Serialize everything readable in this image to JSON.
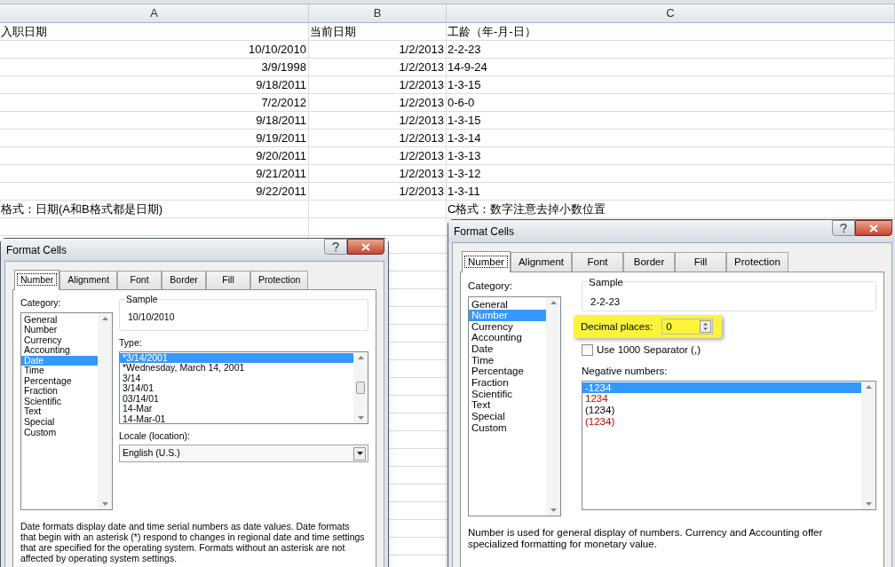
{
  "sheet": {
    "columns": [
      "A",
      "B",
      "C"
    ],
    "header": [
      "入职日期",
      "当前日期",
      "工龄（年-月-日）"
    ],
    "rows": [
      [
        "10/10/2010",
        "1/2/2013",
        "2-2-23"
      ],
      [
        "3/9/1998",
        "1/2/2013",
        "14-9-24"
      ],
      [
        "9/18/2011",
        "1/2/2013",
        "1-3-15"
      ],
      [
        "7/2/2012",
        "1/2/2013",
        "0-6-0"
      ],
      [
        "9/18/2011",
        "1/2/2013",
        "1-3-15"
      ],
      [
        "9/19/2011",
        "1/2/2013",
        "1-3-14"
      ],
      [
        "9/20/2011",
        "1/2/2013",
        "1-3-13"
      ],
      [
        "9/21/2011",
        "1/2/2013",
        "1-3-12"
      ],
      [
        "9/22/2011",
        "1/2/2013",
        "1-3-11"
      ]
    ],
    "note_a": "格式：日期(A和B格式都是日期)",
    "note_c": "C格式：数字注意去掉小数位置"
  },
  "dialogs": [
    {
      "kind": "date",
      "title": "Format Cells",
      "tabs": [
        {
          "label": "Number",
          "selected": true
        },
        {
          "label": "Alignment",
          "selected": false
        },
        {
          "label": "Font",
          "selected": false
        },
        {
          "label": "Border",
          "selected": false
        },
        {
          "label": "Fill",
          "selected": false
        },
        {
          "label": "Protection",
          "selected": false
        }
      ],
      "category_label": "Category:",
      "categories": [
        {
          "label": "General",
          "selected": false
        },
        {
          "label": "Number",
          "selected": false
        },
        {
          "label": "Currency",
          "selected": false
        },
        {
          "label": "Accounting",
          "selected": false
        },
        {
          "label": "Date",
          "selected": true
        },
        {
          "label": "Time",
          "selected": false
        },
        {
          "label": "Percentage",
          "selected": false
        },
        {
          "label": "Fraction",
          "selected": false
        },
        {
          "label": "Scientific",
          "selected": false
        },
        {
          "label": "Text",
          "selected": false
        },
        {
          "label": "Special",
          "selected": false
        },
        {
          "label": "Custom",
          "selected": false
        }
      ],
      "sample_label": "Sample",
      "sample_value": "10/10/2010",
      "type_label": "Type:",
      "types": [
        {
          "label": "*3/14/2001",
          "selected": true
        },
        {
          "label": "*Wednesday, March 14, 2001",
          "selected": false
        },
        {
          "label": "3/14",
          "selected": false
        },
        {
          "label": "3/14/01",
          "selected": false
        },
        {
          "label": "03/14/01",
          "selected": false
        },
        {
          "label": "14-Mar",
          "selected": false
        },
        {
          "label": "14-Mar-01",
          "selected": false
        }
      ],
      "locale_label": "Locale (location):",
      "locale_value": "English (U.S.)",
      "description": "Date formats display date and time serial numbers as date values.  Date formats that begin with an asterisk (*) respond to changes in regional date and time settings that are specified for the operating system. Formats without an asterisk are not affected by operating system settings."
    },
    {
      "kind": "number",
      "title": "Format Cells",
      "tabs": [
        {
          "label": "Number",
          "selected": true
        },
        {
          "label": "Alignment",
          "selected": false
        },
        {
          "label": "Font",
          "selected": false
        },
        {
          "label": "Border",
          "selected": false
        },
        {
          "label": "Fill",
          "selected": false
        },
        {
          "label": "Protection",
          "selected": false
        }
      ],
      "category_label": "Category:",
      "categories": [
        {
          "label": "General",
          "selected": false
        },
        {
          "label": "Number",
          "selected": true
        },
        {
          "label": "Currency",
          "selected": false
        },
        {
          "label": "Accounting",
          "selected": false
        },
        {
          "label": "Date",
          "selected": false
        },
        {
          "label": "Time",
          "selected": false
        },
        {
          "label": "Percentage",
          "selected": false
        },
        {
          "label": "Fraction",
          "selected": false
        },
        {
          "label": "Scientific",
          "selected": false
        },
        {
          "label": "Text",
          "selected": false
        },
        {
          "label": "Special",
          "selected": false
        },
        {
          "label": "Custom",
          "selected": false
        }
      ],
      "sample_label": "Sample",
      "sample_value": "2-2-23",
      "decimal_label": "Decimal places:",
      "decimal_value": "0",
      "separator_label": "Use 1000 Separator (,)",
      "separator_checked": false,
      "negative_label": "Negative numbers:",
      "negatives": [
        {
          "label": "-1234",
          "selected": true
        },
        {
          "label": "1234",
          "selected": false,
          "color": "#cc0000"
        },
        {
          "label": "(1234)",
          "selected": false,
          "color": "#000000"
        },
        {
          "label": "(1234)",
          "selected": false,
          "color": "#cc0000"
        }
      ],
      "description": "Number is used for general display of numbers.  Currency and Accounting offer specialized formatting for monetary value."
    }
  ]
}
